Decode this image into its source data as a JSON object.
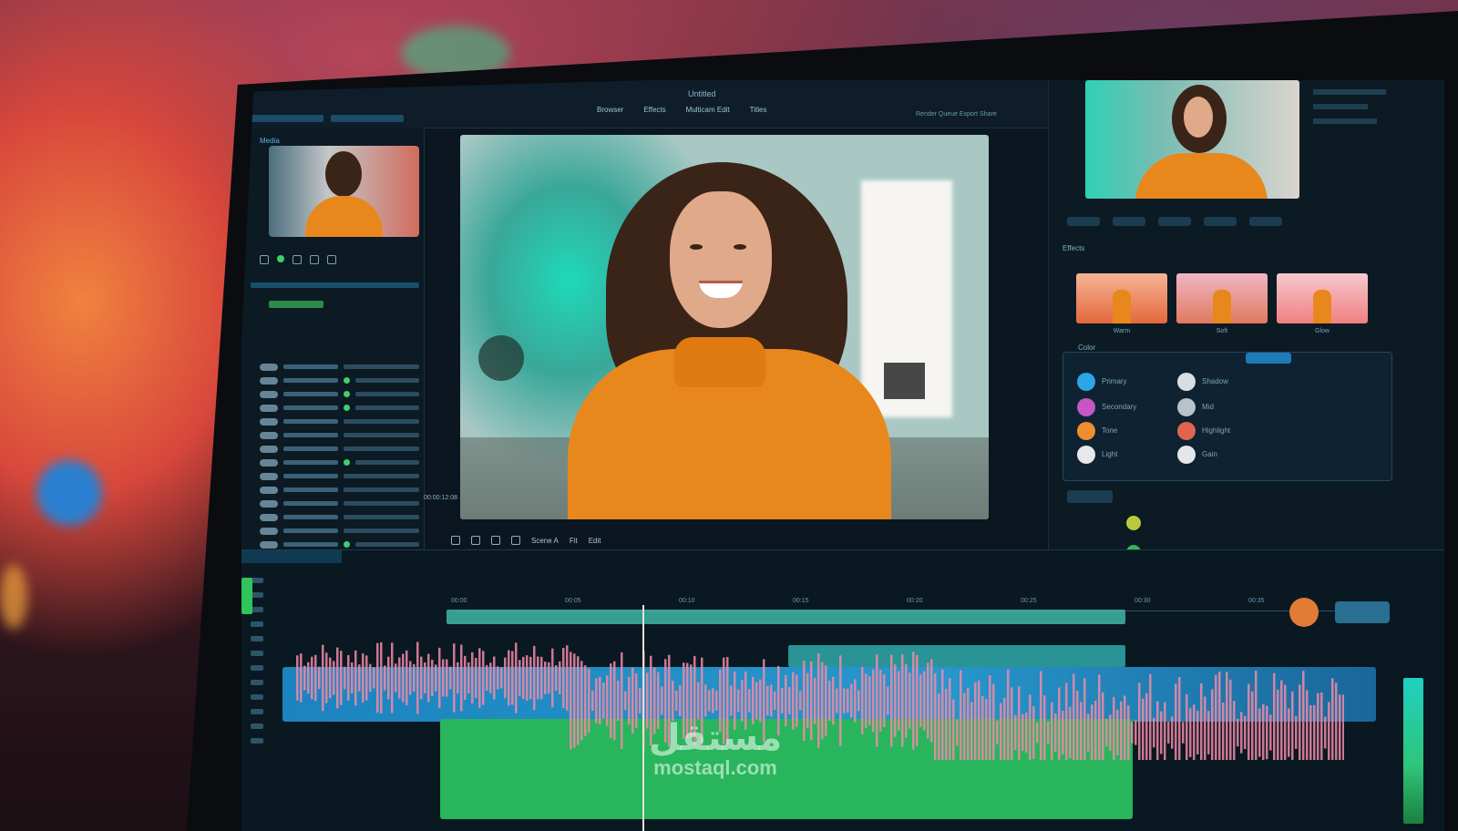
{
  "app": {
    "window_title": "Untitled",
    "menu": [
      "Browser",
      "Effects",
      "Multicam Edit",
      "Titles"
    ],
    "right_status": "Render Queue  Export  Share"
  },
  "left_panel": {
    "source_label": "Media",
    "rows": 14
  },
  "preview": {
    "timecode": "00:00:12:08"
  },
  "transport": {
    "clip_name": "Scene A",
    "zoom": "Fit",
    "mode": "Edit"
  },
  "right_panel": {
    "section_effects": "Effects",
    "section_color": "Color",
    "effects": [
      "Warm",
      "Soft",
      "Glow"
    ],
    "color_labels": [
      "Primary",
      "Secondary",
      "Tone",
      "Light",
      "Shadow",
      "Mid",
      "Highlight",
      "Gain"
    ]
  },
  "timeline": {
    "ruler_ticks": [
      "00:00",
      "00:05",
      "00:10",
      "00:15",
      "00:20",
      "00:25",
      "00:30",
      "00:35"
    ]
  },
  "watermark": {
    "arabic": "مستقل",
    "url": "mostaql.com"
  },
  "colors": {
    "accent_teal": "#3fb7a6",
    "accent_blue": "#1f8fd0",
    "accent_green": "#29b55c",
    "accent_orange": "#e08a2b",
    "wave_pink": "#f08aa6"
  }
}
